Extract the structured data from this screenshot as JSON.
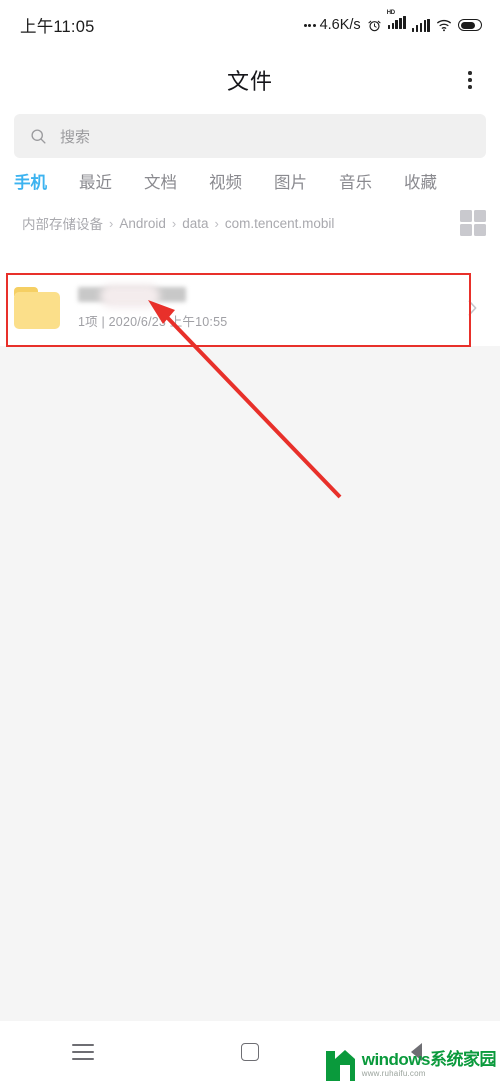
{
  "status_bar": {
    "time": "上午11:05",
    "network_speed": "4.6K/s",
    "icons": [
      "alarm-clock-icon",
      "signal-hd-icon",
      "signal-icon",
      "wifi-icon",
      "battery-icon"
    ],
    "hd_label": "HD",
    "battery_level_percent": 72
  },
  "app_bar": {
    "title": "文件",
    "overflow_menu": "more-options"
  },
  "search": {
    "placeholder": "搜索",
    "value": ""
  },
  "tabs": {
    "active_index": 0,
    "items": [
      {
        "label": "手机"
      },
      {
        "label": "最近"
      },
      {
        "label": "文档"
      },
      {
        "label": "视频"
      },
      {
        "label": "图片"
      },
      {
        "label": "音乐"
      },
      {
        "label": "收藏"
      }
    ]
  },
  "breadcrumb": {
    "separator": "›",
    "items": [
      {
        "label": "内部存储设备"
      },
      {
        "label": "Android"
      },
      {
        "label": "data"
      },
      {
        "label": "com.tencent.mobil"
      }
    ],
    "view_toggle": "grid-view-icon"
  },
  "file_list": {
    "rows": [
      {
        "icon": "folder-icon",
        "name": "",
        "name_redacted": true,
        "meta": "1项 | 2020/6/23 上午10:55",
        "chevron": "chevron-right-icon",
        "highlighted": true
      }
    ]
  },
  "annotation": {
    "color": "#e8302a",
    "rect_label": "highlight-rectangle",
    "arrow_label": "pointer-arrow"
  },
  "nav_bar": {
    "buttons": [
      {
        "icon": "menu-icon",
        "name": "recents-button"
      },
      {
        "icon": "square-icon",
        "name": "home-button"
      },
      {
        "icon": "triangle-left-icon",
        "name": "back-button"
      }
    ]
  },
  "watermark": {
    "title": "windows系统家园",
    "url": "www.ruhaifu.com"
  },
  "colors": {
    "accent_tab": "#3cb3f0",
    "folder": "#fbdf8a",
    "annotation": "#e8302a",
    "watermark_green": "#0a9a3c",
    "list_background": "#f5f5f5",
    "search_background": "#f0f0f0"
  }
}
